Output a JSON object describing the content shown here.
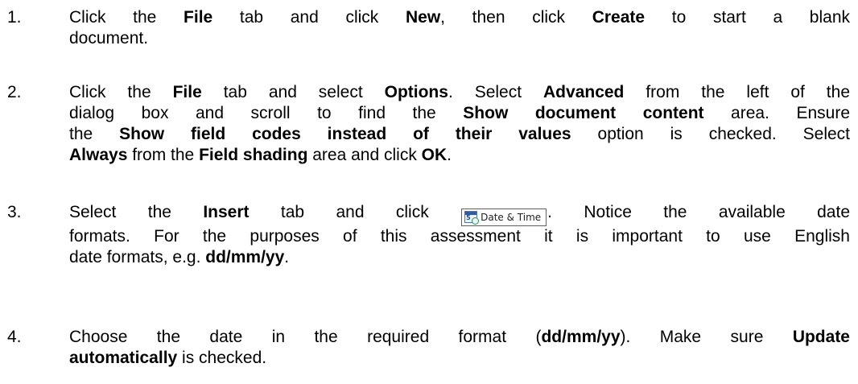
{
  "steps": [
    {
      "num": "1.",
      "line1": {
        "t1": "Click the ",
        "b1": "File",
        "t2": " tab and click ",
        "b2": "New",
        "t3": ", then click ",
        "b3": "Create",
        "t4": " to start a blank"
      },
      "line2": {
        "t1": "document."
      }
    },
    {
      "num": "2.",
      "line1": {
        "t1": "Click the ",
        "b1": "File",
        "t2": " tab and select ",
        "b2": "Options",
        "t3": ". Select ",
        "b3": "Advanced",
        "t4": " from the left of the"
      },
      "line2": {
        "t1": "dialog box and scroll to find the ",
        "b1": "Show document content",
        "t2": " area. Ensure"
      },
      "line3": {
        "t1": "the ",
        "b1": "Show field codes instead of their values",
        "t2": " option is checked. Select"
      },
      "line4": {
        "b1": "Always",
        "t1": " from the ",
        "b2": "Field shading",
        "t2": " area and click ",
        "b3": "OK",
        "t3": "."
      }
    },
    {
      "num": "3.",
      "line1": {
        "t1": "Select the ",
        "b1": "Insert",
        "t2": " tab and click ",
        "t3": ". Notice the available date"
      },
      "button": {
        "icon": "date-time-calendar-icon",
        "icon_text": "5",
        "label": "Date & Time"
      },
      "line2": {
        "t1": "formats. For the purposes of this assessment it is important to use English"
      },
      "line3": {
        "t1": "date formats, e.g. ",
        "b1": "dd/mm/yy",
        "t2": "."
      }
    },
    {
      "num": "4.",
      "line1": {
        "t1": "Choose the date in the required format (",
        "b1": "dd/mm/yy",
        "t2": "). Make sure ",
        "b2": "Update"
      },
      "line2": {
        "b1": "automatically",
        "t1": " is checked."
      }
    }
  ]
}
